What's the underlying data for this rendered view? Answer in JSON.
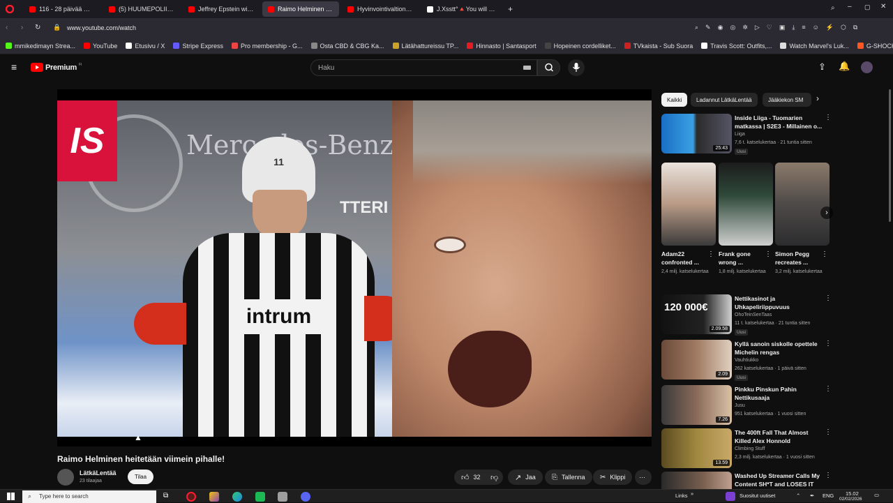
{
  "browser": {
    "tabs": [
      {
        "label": "116 - 28 päivää myöhemm",
        "color": "#ff0000",
        "active": false
      },
      {
        "label": "(5) HUUMEPOLIISI HUUM",
        "color": "#ff0000",
        "active": false
      },
      {
        "label": "Jeffrey Epstein with Steve",
        "color": "#ff0000",
        "active": false
      },
      {
        "label": "Raimo Helminen heit",
        "color": "#ff0000",
        "active": true
      },
      {
        "label": "Hyvinvointivaltion TUHO",
        "color": "#ff0000",
        "active": false
      },
      {
        "label": "J.Xsstt°🔺You will never",
        "color": "#ffffff",
        "active": false
      }
    ],
    "url": "www.youtube.com/watch",
    "bookmarks": [
      {
        "label": "mmikedimayn Strea...",
        "color": "#53fc18"
      },
      {
        "label": "YouTube",
        "color": "#ff0000"
      },
      {
        "label": "Etusivu / X",
        "color": "#ffffff"
      },
      {
        "label": "Stripe Express",
        "color": "#635bff"
      },
      {
        "label": "Pro membership - G...",
        "color": "#e44"
      },
      {
        "label": "Osta CBD & CBG Ka...",
        "color": "#888"
      },
      {
        "label": "Lätähattureissu TP...",
        "color": "#c9a227"
      },
      {
        "label": "Hinnasto | Santasport",
        "color": "#e31b23"
      },
      {
        "label": "Hopeinen cordelliket...",
        "color": "#444"
      },
      {
        "label": "TVkaista - Sub Suora",
        "color": "#cc2222"
      },
      {
        "label": "Travis Scott: Outfits,...",
        "color": "#ffffff"
      },
      {
        "label": "Watch Marvel's Luk...",
        "color": "#dddddd"
      },
      {
        "label": "G-SHOCK UNISEX -...",
        "color": "#ff5722"
      }
    ]
  },
  "youtube": {
    "logo_text": "Premium",
    "logo_suffix": "FI",
    "search_placeholder": "Haku",
    "video": {
      "title": "Raimo Helminen heitetään viimein pihalle!",
      "channel": "LätkäLentää",
      "subscribers": "23 tilaajaa",
      "subscribe_label": "Tilaa",
      "likes": "32",
      "share_label": "Jaa",
      "save_label": "Tallenna",
      "clip_label": "Klippi",
      "overlay": {
        "badge": "IS",
        "banner_text": "Mercedes-Benz",
        "ad_text": "TTERI",
        "helmet_number": "11",
        "jersey_text": "intrum"
      }
    },
    "chips": [
      "Kaikki",
      "Ladannut LätkäLentää",
      "Jääkiekon SM"
    ],
    "recs_top": {
      "title": "Inside Liiga - Tuomarien matkassa | S2E3 - Millainen o...",
      "channel": "Liiga",
      "meta": "7,6 t. katselukertaa · 21 tuntia sitten",
      "badge": "Uusi",
      "duration": "25:43"
    },
    "shorts": [
      {
        "title": "Adam22 confronted ...",
        "views": "2,4 milj. katselukertaa"
      },
      {
        "title": "Frank gone wrong ...",
        "views": "1,8 milj. katselukertaa"
      },
      {
        "title": "Simon Pegg recreates ...",
        "views": "3,2 milj. katselukertaa"
      }
    ],
    "recs": [
      {
        "title": "Nettikasinot ja Uhkapeliriippuvuus",
        "channel": "OhoTeinSenTaas",
        "meta": "11 t. katselukertaa · 21 tuntia sitten",
        "badge": "Uusi",
        "duration": "2.09.58",
        "thumb_text": "120 000€"
      },
      {
        "title": "Kyllä sanoin siskolle opettele Michelin rengas",
        "channel": "Vauhtiukko",
        "meta": "262 katselukertaa · 1 päivä sitten",
        "badge": "Uusi",
        "duration": "2.09",
        "thumb_text": ""
      },
      {
        "title": "Pinkku Pinskun Pahin Nettikusaaja",
        "channel": "Jusu",
        "meta": "951 katselukertaa · 1 vuosi sitten",
        "badge": "",
        "duration": "7.26",
        "thumb_text": ""
      },
      {
        "title": "The 400ft Fall That Almost Killed Alex Honnold",
        "channel": "Climbing Stuff",
        "meta": "2,3 milj. katselukertaa · 1 vuosi sitten",
        "badge": "",
        "duration": "13.59",
        "thumb_text": ""
      },
      {
        "title": "Washed Up Streamer Calls My Content SH*T and LOSES IT",
        "channel": "",
        "meta": "",
        "badge": "",
        "duration": "",
        "thumb_text": ""
      }
    ]
  },
  "taskbar": {
    "search_placeholder": "Type here to search",
    "links_label": "Links",
    "news_label": "Suositut uutiset",
    "lang": "ENG",
    "time": "15.02",
    "date": "02/02/2026"
  }
}
